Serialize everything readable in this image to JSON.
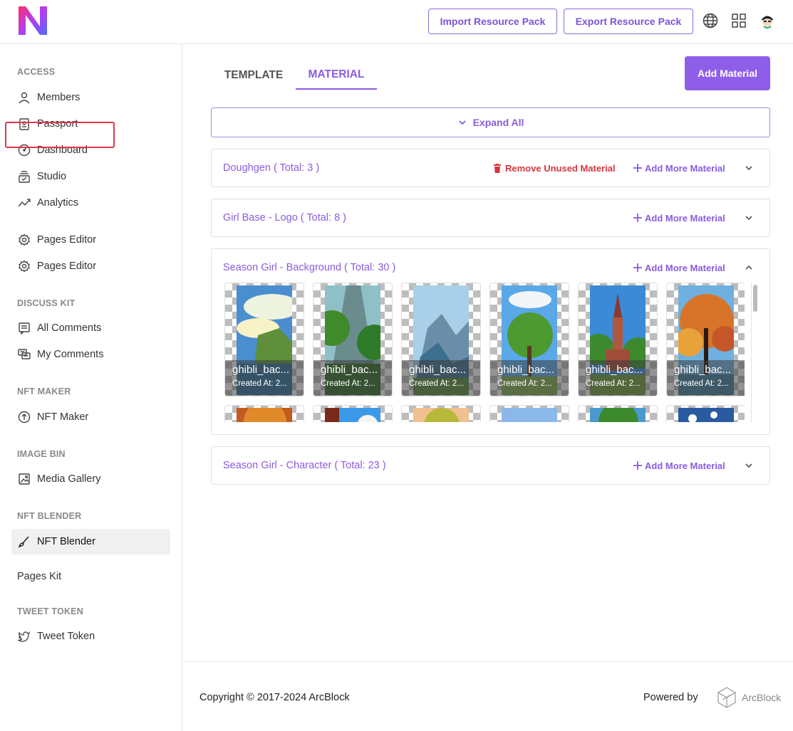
{
  "header": {
    "import_label": "Import Resource Pack",
    "export_label": "Export Resource Pack"
  },
  "sidebar": {
    "sections": {
      "access": "ACCESS",
      "discuss_kit": "DISCUSS KIT",
      "nft_maker": "NFT MAKER",
      "image_bin": "IMAGE BIN",
      "nft_blender": "NFT BLENDER",
      "tweet_token": "TWEET TOKEN"
    },
    "items": {
      "members": "Members",
      "passport": "Passport",
      "dashboard": "Dashboard",
      "studio": "Studio",
      "analytics": "Analytics",
      "pages_editor_1": "Pages Editor",
      "pages_editor_2": "Pages Editor",
      "all_comments": "All Comments",
      "my_comments": "My Comments",
      "nft_maker": "NFT Maker",
      "media_gallery": "Media Gallery",
      "nft_blender": "NFT Blender",
      "pages_kit": "Pages Kit",
      "tweet_token": "Tweet Token"
    }
  },
  "main": {
    "tabs": [
      "TEMPLATE",
      "MATERIAL"
    ],
    "active_tab": "MATERIAL",
    "add_material_label": "Add Material",
    "expand_all_label": "Expand All",
    "remove_unused_label": "Remove Unused Material",
    "add_more_label": "Add More Material",
    "panels": [
      {
        "title": "Doughgen ( Total: 3 )"
      },
      {
        "title": "Girl Base - Logo ( Total: 8 )"
      },
      {
        "title": "Season Girl - Background ( Total: 30 )"
      },
      {
        "title": "Season Girl - Character ( Total: 23 )"
      }
    ],
    "cards": [
      {
        "name": "ghibli_bac...",
        "created": "Created At: 2..."
      },
      {
        "name": "ghibli_bac...",
        "created": "Created At: 2..."
      },
      {
        "name": "ghibli_bac...",
        "created": "Created At: 2..."
      },
      {
        "name": "ghibli_bac...",
        "created": "Created At: 2..."
      },
      {
        "name": "ghibli_bac...",
        "created": "Created At: 2..."
      },
      {
        "name": "ghibli_bac...",
        "created": "Created At: 2..."
      }
    ]
  },
  "footer": {
    "copyright": "Copyright © 2017-2024  ArcBlock",
    "powered_by": "Powered by",
    "brand": "ArcBlock"
  },
  "colors": {
    "accent": "#8a5ce0",
    "danger": "#d9363e",
    "highlight": "#e0364e"
  }
}
